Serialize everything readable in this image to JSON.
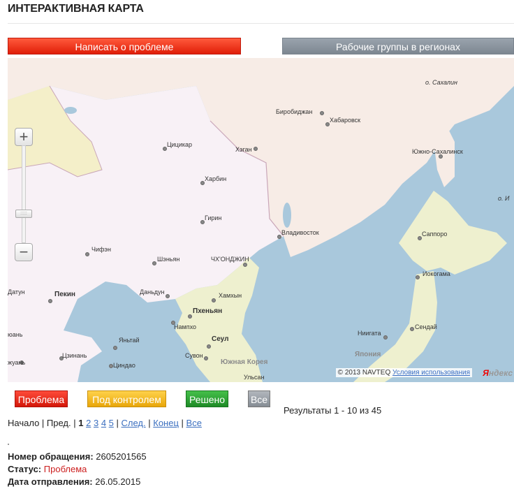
{
  "header": {
    "title": "ИНТЕРАКТИВНАЯ КАРТА"
  },
  "actions": {
    "report_label": "Написать о проблеме",
    "groups_label": "Рабочие группы в регионах"
  },
  "map": {
    "zoom_in": "+",
    "zoom_out": "−",
    "handle": ":::::",
    "labels": {
      "sakhalin": "о. Сахалин",
      "birobidzhan": "Биробиджан",
      "khabarovsk": "Хабаровск",
      "tsitsikar": "Цицикар",
      "hegan": "Хэган",
      "yuzhno": "Южно-Сахалинск",
      "harbin": "Харбин",
      "girin": "Гирин",
      "vladivostok": "Владивосток",
      "sapporo": "Саппоро",
      "chifen": "Чифэн",
      "shenyan": "Шэньян",
      "chkhondzhin": "ЧХ'ОНДЖИН",
      "iokogama": "Иокогама",
      "datun": "Датун",
      "pekin": "Пекин",
      "dandun": "Даньдун",
      "hamhyn": "Хамхын",
      "phenyan": "Пхеньян",
      "nampo": "Нампхо",
      "niigata": "Ниигата",
      "sendai": "Сендай",
      "yuan": "юань",
      "yantai": "Яньтай",
      "seul": "Сеул",
      "yaponiya": "Япония",
      "zhuan": "жуань",
      "tsinan": "Цзинань",
      "suvon": "Сувон",
      "tsindao": "Циндао",
      "yuzhkor": "Южная Корея",
      "ulsan": "Ульсан",
      "o_i": "о. И"
    },
    "copyright_prefix": "© 2013 NAVTEQ",
    "terms_link": "Условия использования",
    "logo_y": "Я",
    "logo_rest": "ндекс"
  },
  "filters": {
    "problem": "Проблема",
    "control": "Под контролем",
    "solved": "Решено",
    "all": "Все"
  },
  "results": "Результаты 1 - 10 из 45",
  "pager": {
    "start": "Начало",
    "prev": "Пред.",
    "current": "1",
    "pages": [
      "2",
      "3",
      "4",
      "5"
    ],
    "next": "След.",
    "end": "Конец",
    "all": "Все"
  },
  "record": {
    "number_label": "Номер обращения:",
    "number_value": "2605201565",
    "status_label": "Статус:",
    "status_value": "Проблема",
    "date_label": "Дата отправления:",
    "date_value": "26.05.2015"
  },
  "colors": {
    "accent_red": "#e01e08",
    "grey_button": "#7d8791",
    "link": "#3b6fbf",
    "sea": "#a9c8dc",
    "land_china": "#f8f1f6",
    "land_russia": "#f7ece6"
  }
}
